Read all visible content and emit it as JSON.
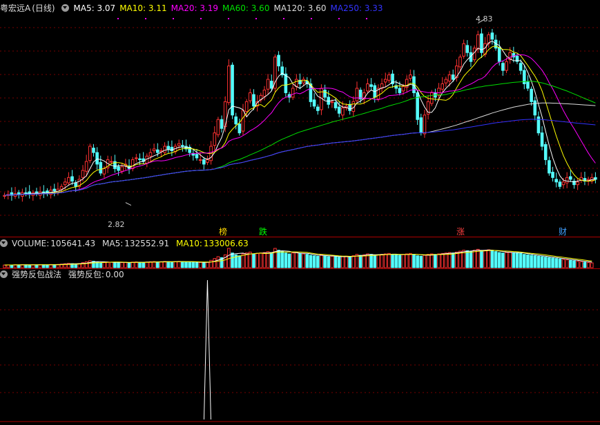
{
  "title": "粤宏远A",
  "period": "(日线)",
  "ma_legend": [
    {
      "label": "MA5:",
      "value": "3.07",
      "color": "#ffffff"
    },
    {
      "label": "MA10:",
      "value": "3.11",
      "color": "#ffff00"
    },
    {
      "label": "MA20:",
      "value": "3.19",
      "color": "#ff00ff"
    },
    {
      "label": "MA60:",
      "value": "3.60",
      "color": "#00e000"
    },
    {
      "label": "MA120:",
      "value": "3.60",
      "color": "#dddddd"
    },
    {
      "label": "MA250:",
      "value": "3.33",
      "color": "#3333ff"
    }
  ],
  "volume_legend": {
    "label": "VOLUME:",
    "value": "105641.43",
    "ma5_label": "MA5:",
    "ma5": "132552.91",
    "ma10_label": "MA10:",
    "ma10": "133006.63"
  },
  "indicator_legend": {
    "name": "强势反包战法",
    "series_label": "强势反包:",
    "value": "0.00"
  },
  "annotations": {
    "high_label": "4.83",
    "low_label": "2.82",
    "tags": [
      {
        "text": "榜",
        "color": "#ffd700"
      },
      {
        "text": "跌",
        "color": "#00ff00"
      },
      {
        "text": "涨",
        "color": "#ff4040"
      },
      {
        "text": "财",
        "color": "#40a0ff"
      }
    ]
  },
  "chart_data": {
    "type": "candlestick",
    "price_range": [
      2.6,
      4.95
    ],
    "high": 4.83,
    "low": 2.82,
    "ma_lines": [
      "MA5",
      "MA10",
      "MA20",
      "MA60",
      "MA120",
      "MA250"
    ],
    "colors": {
      "up": "#ff3232",
      "down": "#54fcfc"
    },
    "close": [
      2.9,
      2.91,
      2.9,
      2.92,
      2.91,
      2.93,
      2.92,
      2.91,
      2.93,
      2.92,
      2.94,
      2.93,
      2.92,
      2.96,
      2.95,
      2.97,
      3.0,
      3.05,
      3.1,
      3.06,
      3.0,
      3.08,
      3.18,
      3.28,
      3.45,
      3.38,
      3.25,
      3.15,
      3.2,
      3.3,
      3.28,
      3.2,
      3.18,
      3.22,
      3.25,
      3.2,
      3.3,
      3.32,
      3.3,
      3.28,
      3.34,
      3.38,
      3.42,
      3.38,
      3.4,
      3.45,
      3.42,
      3.4,
      3.45,
      3.48,
      3.45,
      3.42,
      3.38,
      3.35,
      3.32,
      3.3,
      3.25,
      3.3,
      3.45,
      3.6,
      3.75,
      3.65,
      3.95,
      4.35,
      3.8,
      3.7,
      3.6,
      3.85,
      3.95,
      4.05,
      3.9,
      3.95,
      4.02,
      4.08,
      4.2,
      4.1,
      4.45,
      4.35,
      4.25,
      4.05,
      4.0,
      4.1,
      4.2,
      4.15,
      4.2,
      4.15,
      3.95,
      3.9,
      3.85,
      4.1,
      4.0,
      3.92,
      3.95,
      3.88,
      3.82,
      3.88,
      3.9,
      3.85,
      3.95,
      4.1,
      3.98,
      4.05,
      4.15,
      4.12,
      4.0,
      4.1,
      4.15,
      4.2,
      4.25,
      4.15,
      4.1,
      4.05,
      4.12,
      4.2,
      4.25,
      4.05,
      3.75,
      3.6,
      3.8,
      3.95,
      4.05,
      4.0,
      4.1,
      4.15,
      4.2,
      4.25,
      4.2,
      4.35,
      4.45,
      4.6,
      4.5,
      4.4,
      4.55,
      4.7,
      4.5,
      4.6,
      4.7,
      4.65,
      4.55,
      4.4,
      4.3,
      4.4,
      4.5,
      4.45,
      4.4,
      4.3,
      4.15,
      4.1,
      3.95,
      3.8,
      3.6,
      3.45,
      3.3,
      3.15,
      3.1,
      3.05,
      3.0,
      3.05,
      3.1,
      3.08,
      3.02,
      3.05,
      3.1,
      3.06,
      3.08,
      3.1,
      3.08
    ],
    "volume": [
      58,
      62,
      60,
      64,
      61,
      66,
      63,
      60,
      65,
      62,
      66,
      64,
      62,
      70,
      68,
      72,
      78,
      86,
      95,
      88,
      80,
      90,
      110,
      130,
      150,
      140,
      120,
      110,
      115,
      125,
      120,
      110,
      108,
      112,
      118,
      110,
      122,
      126,
      120,
      116,
      124,
      130,
      134,
      128,
      130,
      136,
      132,
      128,
      134,
      138,
      132,
      128,
      124,
      120,
      116,
      114,
      110,
      118,
      160,
      200,
      240,
      220,
      280,
      420,
      320,
      280,
      260,
      300,
      320,
      340,
      300,
      310,
      320,
      330,
      350,
      330,
      420,
      380,
      360,
      320,
      300,
      320,
      330,
      310,
      300,
      290,
      270,
      260,
      250,
      280,
      260,
      240,
      250,
      240,
      230,
      240,
      250,
      240,
      260,
      290,
      270,
      280,
      300,
      290,
      270,
      280,
      290,
      300,
      310,
      290,
      280,
      270,
      290,
      300,
      310,
      290,
      260,
      250,
      270,
      290,
      300,
      290,
      300,
      310,
      320,
      330,
      320,
      340,
      360,
      380,
      370,
      360,
      380,
      400,
      370,
      380,
      390,
      370,
      350,
      330,
      320,
      330,
      340,
      330,
      320,
      310,
      290,
      280,
      270,
      260,
      250,
      240,
      230,
      220,
      210,
      200,
      190,
      180,
      170,
      160,
      150,
      140,
      130,
      120,
      110,
      105
    ],
    "signal_spike_bar": 57,
    "signal_spike_value": 1.0
  }
}
